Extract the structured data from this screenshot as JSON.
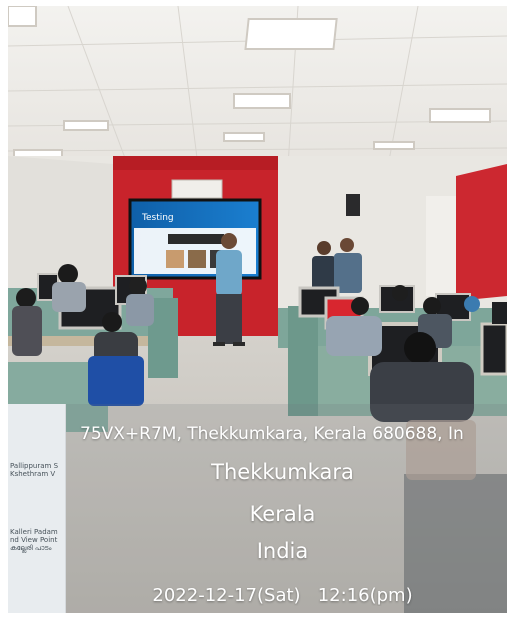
{
  "map_thumbnail": {
    "labels": [
      "Pallippuram S",
      "Kshethram V",
      "Kalleri Padam",
      "nd View Point",
      "കല്ലേരി പാടം"
    ]
  },
  "geotag": {
    "address": "75VX+R7M, Thekkumkara, Kerala 680688, In",
    "city": "Thekkumkara",
    "state": "Kerala",
    "country": "India",
    "datetime": "2022-12-17(Sat)   12:16(pm)"
  },
  "projector_screen": {
    "title": "Testing"
  },
  "colors": {
    "red_wall": "#c8232b",
    "ceiling": "#efedea",
    "cubicle_teal": "#7fa79c",
    "monitor_dark": "#1e1f22"
  }
}
